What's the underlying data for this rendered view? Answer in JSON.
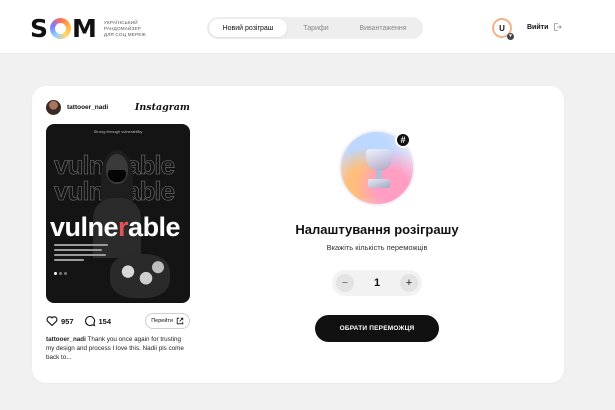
{
  "brand": {
    "name_left": "S",
    "name_right": "M",
    "tagline": [
      "Український",
      "рандомайзер",
      "для соц мереж"
    ]
  },
  "nav": {
    "tabs": [
      {
        "label": "Новий розіграш",
        "active": true
      },
      {
        "label": "Тарифи",
        "active": false
      },
      {
        "label": "Вивантаження",
        "active": false
      }
    ]
  },
  "user": {
    "initial": "U",
    "logout_label": "Вийти"
  },
  "post": {
    "username": "tattooer_nadi",
    "platform": "Instagram",
    "image": {
      "caption": "Strong through vulnerability",
      "ghost_word": "vulnerable",
      "main_word_left": "vulne",
      "main_word_accent": "r",
      "main_word_right": "able"
    },
    "likes": "957",
    "comments": "154",
    "go_label": "Перейти",
    "caption_user": "tattooer_nadi",
    "caption_text": " Thank you once again for trusting my design and process I love this. Nadii pls come back to..."
  },
  "settings": {
    "badge": "#",
    "title": "Налаштування розіграшу",
    "subtitle": "Вкажіть кількість переможців",
    "minus": "−",
    "plus": "+",
    "winners": "1",
    "submit_label": "ОБРАТИ ПЕРЕМОЖЦЯ"
  }
}
